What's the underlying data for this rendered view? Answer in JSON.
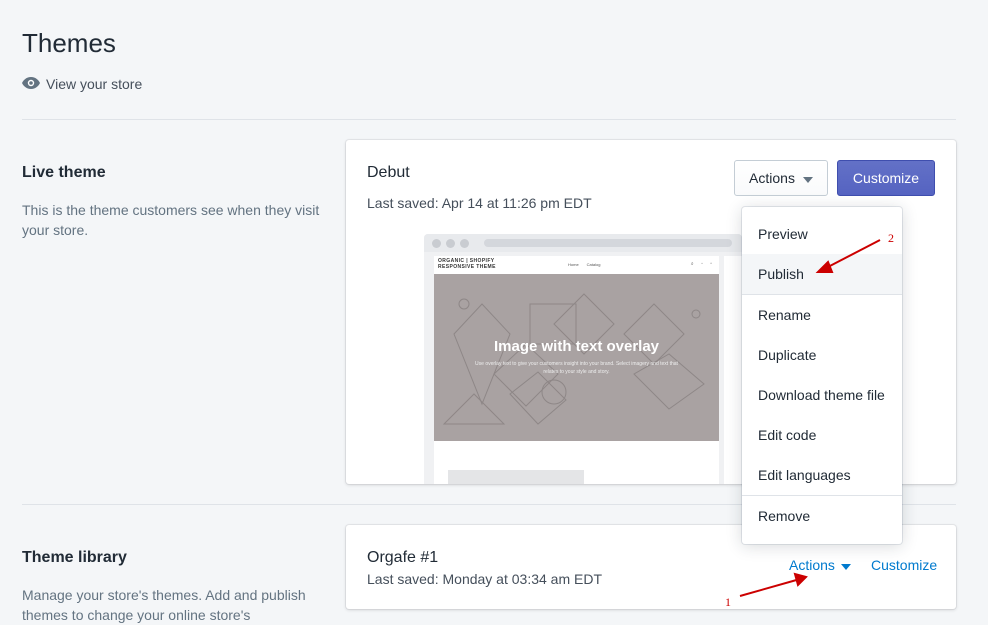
{
  "page": {
    "title": "Themes",
    "view_store": "View your store"
  },
  "live_section": {
    "title": "Live theme",
    "description": "This is the theme customers see when they visit your store.",
    "card": {
      "theme_name": "Debut",
      "last_saved": "Last saved: Apr 14 at 11:26 pm EDT",
      "actions_label": "Actions",
      "customize_label": "Customize",
      "preview": {
        "brand": [
          "ORGANIC | SHOPIFY",
          "RESPONSIVE THEME"
        ],
        "nav": [
          "Home",
          "Catalog"
        ],
        "hero_title": "Image with text overlay",
        "hero_subtitle": "Use overlay text to give your customers insight into your brand. Select imagery and text that relates to your style and story."
      }
    }
  },
  "actions_menu": {
    "items": [
      "Preview",
      "Publish",
      "Rename",
      "Duplicate",
      "Download theme file",
      "Edit code",
      "Edit languages",
      "Remove"
    ],
    "hovered": "Publish"
  },
  "library_section": {
    "title": "Theme library",
    "description": "Manage your store's themes. Add and publish themes to change your online store's",
    "card": {
      "theme_name": "Orgafe #1",
      "last_saved": "Last saved: Monday at 03:34 am EDT",
      "actions_label": "Actions",
      "customize_label": "Customize"
    }
  },
  "annotations": {
    "step1": "1",
    "step2": "2"
  },
  "colors": {
    "primary": "#5c6ac4",
    "link": "#007ace",
    "annotation": "#cc0000"
  },
  "icons": {
    "view_store": "eye-icon",
    "actions_caret": "caret-down-icon"
  }
}
